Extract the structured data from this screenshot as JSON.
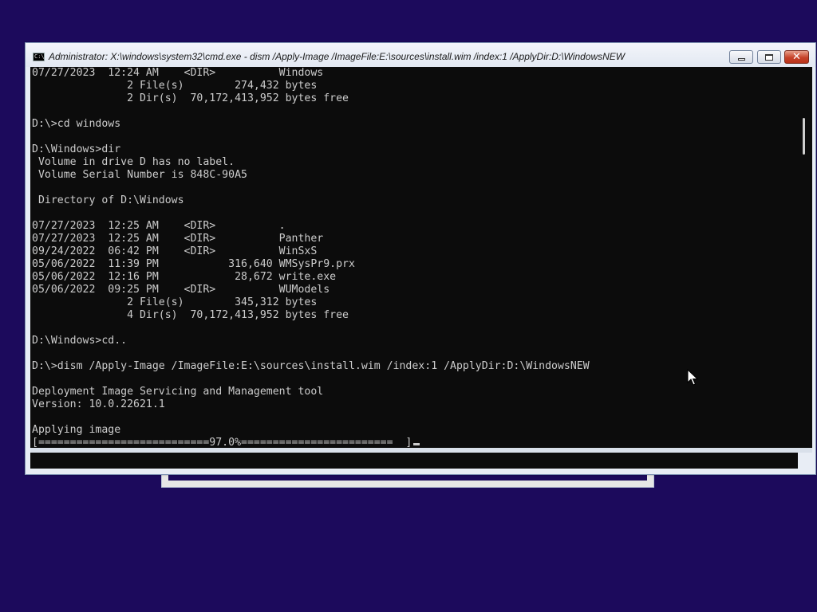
{
  "window": {
    "title": "Administrator: X:\\windows\\system32\\cmd.exe - dism  /Apply-Image /ImageFile:E:\\sources\\install.wim /index:1 /ApplyDir:D:\\WindowsNEW",
    "app_icon_label": "C:\\",
    "icon_semantics": [
      "cmd-icon",
      "minimize-icon",
      "maximize-icon",
      "close-icon",
      "mouse-pointer-icon"
    ],
    "close_color": "#c7432a"
  },
  "console": {
    "background": "#0c0c0c",
    "foreground": "#cccccc",
    "lines": [
      "07/27/2023  12:24 AM    <DIR>          Windows",
      "               2 File(s)        274,432 bytes",
      "               2 Dir(s)  70,172,413,952 bytes free",
      "",
      "D:\\>cd windows",
      "",
      "D:\\Windows>dir",
      " Volume in drive D has no label.",
      " Volume Serial Number is 848C-90A5",
      "",
      " Directory of D:\\Windows",
      "",
      "07/27/2023  12:25 AM    <DIR>          .",
      "07/27/2023  12:25 AM    <DIR>          Panther",
      "09/24/2022  06:42 PM    <DIR>          WinSxS",
      "05/06/2022  11:39 PM           316,640 WMSysPr9.prx",
      "05/06/2022  12:16 PM            28,672 write.exe",
      "05/06/2022  09:25 PM    <DIR>          WUModels",
      "               2 File(s)        345,312 bytes",
      "               4 Dir(s)  70,172,413,952 bytes free",
      "",
      "D:\\Windows>cd..",
      "",
      "D:\\>dism /Apply-Image /ImageFile:E:\\sources\\install.wim /index:1 /ApplyDir:D:\\WindowsNEW",
      "",
      "Deployment Image Servicing and Management tool",
      "Version: 10.0.22621.1",
      "",
      "Applying image"
    ],
    "progress_line": "[===========================97.0%========================  ]",
    "progress_percent": 97.0
  },
  "desktop_background": "#1c0a5c"
}
